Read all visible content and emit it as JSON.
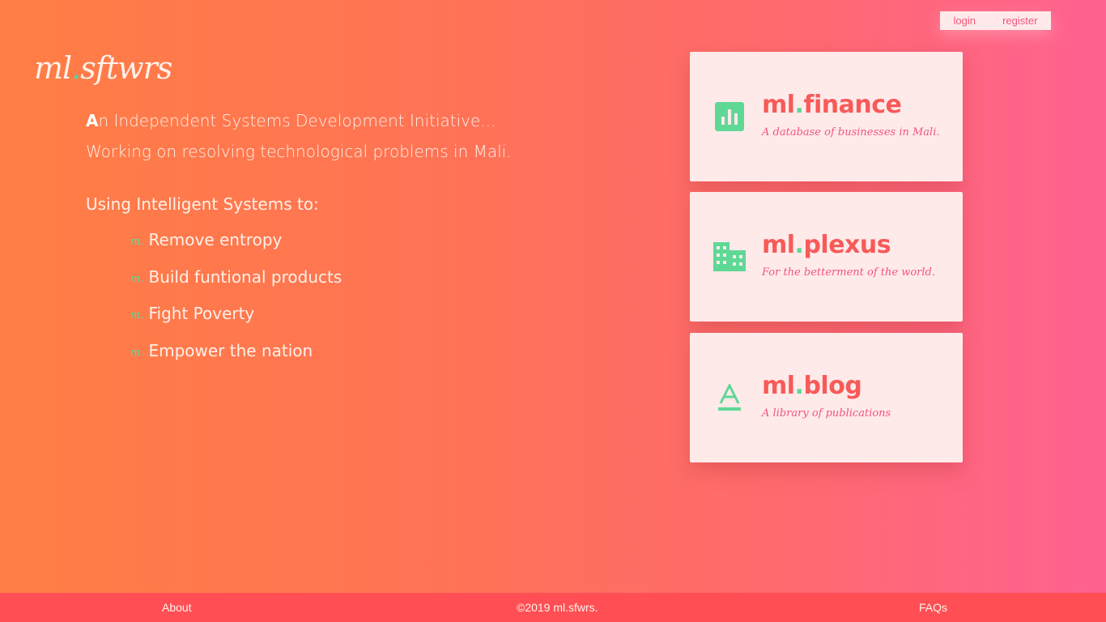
{
  "nav": {
    "login": "login",
    "register": "register"
  },
  "brand": {
    "left": "ml",
    "dot": ".",
    "right": "sftwrs"
  },
  "intro": {
    "cap": "A",
    "line1_rest": "n Independent Systems Development Initiative...",
    "line2": "Working on resolving technological problems in Mali."
  },
  "using": "Using Intelligent Systems to:",
  "goals": {
    "bullet": "m.",
    "items": [
      "Remove entropy",
      "Build funtional products",
      "Fight Poverty",
      "Empower the nation"
    ]
  },
  "cards": [
    {
      "prefix": "ml",
      "dot": ".",
      "name": "finance",
      "subtitle": "A database of businesses in Mali.",
      "icon": "bar-chart-icon"
    },
    {
      "prefix": "ml",
      "dot": ".",
      "name": "plexus",
      "subtitle": "For the betterment of the world.",
      "icon": "building-icon"
    },
    {
      "prefix": "ml",
      "dot": ".",
      "name": "blog",
      "subtitle": "A library of publications",
      "icon": "text-format-icon"
    }
  ],
  "footer": {
    "about": "About",
    "copyright": "©2019 ml.sfwrs.",
    "faqs": "FAQs"
  },
  "colors": {
    "accent": "#5fd896",
    "card_title": "#f75a58",
    "card_sub": "#f2557a",
    "footer_bg": "#ff4f54"
  }
}
